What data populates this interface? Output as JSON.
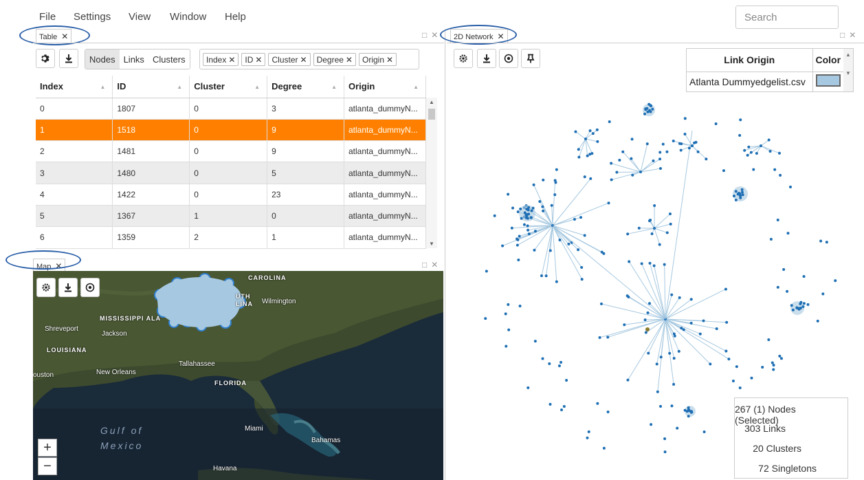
{
  "menu": {
    "file": "File",
    "settings": "Settings",
    "view": "View",
    "window": "Window",
    "help": "Help"
  },
  "search": {
    "placeholder": "Search"
  },
  "panels": {
    "table_tab": "Table",
    "network_tab": "2D Network",
    "map_tab": "Map"
  },
  "table": {
    "segments": [
      "Nodes",
      "Links",
      "Clusters"
    ],
    "active_segment": "Nodes",
    "chips": [
      "Index",
      "ID",
      "Cluster",
      "Degree",
      "Origin"
    ],
    "columns": [
      "Index",
      "ID",
      "Cluster",
      "Degree",
      "Origin"
    ],
    "rows": [
      [
        "0",
        "1807",
        "0",
        "3",
        "atlanta_dummyN..."
      ],
      [
        "1",
        "1518",
        "0",
        "9",
        "atlanta_dummyN..."
      ],
      [
        "2",
        "1481",
        "0",
        "9",
        "atlanta_dummyN..."
      ],
      [
        "3",
        "1480",
        "0",
        "5",
        "atlanta_dummyN..."
      ],
      [
        "4",
        "1422",
        "0",
        "23",
        "atlanta_dummyN..."
      ],
      [
        "5",
        "1367",
        "1",
        "0",
        "atlanta_dummyN..."
      ],
      [
        "6",
        "1359",
        "2",
        "1",
        "atlanta_dummyN..."
      ]
    ],
    "selected_row_index": 1
  },
  "map": {
    "labels": {
      "carolina": "CAROLINA",
      "wilmington": "Wilmington",
      "mississippi": "MISSISSIPPI ALA",
      "shreveport": "Shreveport",
      "jackson": "Jackson",
      "louisiana": "LOUISIANA",
      "tallahassee": "Tallahassee",
      "houston": "ouston",
      "new_orleans": "New Orleans",
      "florida": "FLORIDA",
      "gulf1": "Gulf of",
      "gulf2": "Mexico",
      "miami": "Miami",
      "bahamas": "Bahamas",
      "havana": "Havana",
      "south": "UTH",
      "lina": "LINA"
    },
    "zoom_in": "+",
    "zoom_out": "−"
  },
  "network": {
    "legend_header_origin": "Link Origin",
    "legend_header_color": "Color",
    "legend_origin": "Atlanta Dummyedgelist.csv",
    "legend_color": "#a6c8e0",
    "node_color": "#1f6fb4",
    "link_color": "#a6c8e0",
    "selected_node_color": "#8a7a30",
    "stats": {
      "nodes": "267 (1) Nodes (Selected)",
      "links": "303 Links",
      "clusters": "20 Clusters",
      "singletons": "72 Singletons"
    }
  }
}
